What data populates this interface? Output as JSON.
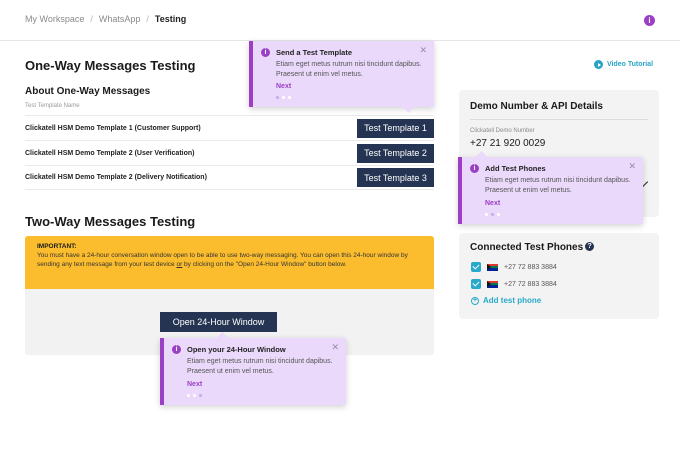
{
  "breadcrumb": {
    "items": [
      "My Workspace",
      "WhatsApp"
    ],
    "current": "Testing"
  },
  "one_way": {
    "title": "One-Way Messages Testing",
    "about": "About One-Way Messages",
    "column_label": "Test Template Name",
    "templates": [
      {
        "name": "Clickatell HSM Demo Template 1 (Customer Support)",
        "button": "Test Template 1"
      },
      {
        "name": "Clickatell HSM Demo Template 2 (User Verification)",
        "button": "Test Template 2"
      },
      {
        "name": "Clickatell HSM Demo Template 2 (Delivery Notification)",
        "button": "Test Template 3"
      }
    ]
  },
  "video_tutorial": "Video Tutorial",
  "demo_card": {
    "title": "Demo Number & API Details",
    "number_label": "Clickatell Demo Number",
    "number": "+27 21 920 0029"
  },
  "phones_card": {
    "title": "Connected Test Phones",
    "phones": [
      "+27 72 883 3884",
      "+27 72 883 3884"
    ],
    "add_label": "Add test phone"
  },
  "two_way": {
    "title": "Two-Way Messages Testing",
    "important_label": "IMPORTANT:",
    "important_text_1": "You must have a 24-hour conversation window open to be able to use two-way messaging. You can open this 24-hour window by sending any text message from your test device ",
    "important_or": "or",
    "important_text_2": " by clicking on the \"Open 24-Hour Window\" button below.",
    "open_button": "Open 24-Hour Window"
  },
  "tooltips": {
    "send": {
      "title": "Send a Test Template",
      "body": "Etiam eget metus rutrum nisi tincidunt dapibus. Praesent ut enim vel metus.",
      "next": "Next"
    },
    "phones": {
      "title": "Add Test Phones",
      "body": "Etiam eget metus rutrum nisi tincidunt dapibus. Praesent ut enim vel metus.",
      "next": "Next"
    },
    "window": {
      "title": "Open your 24-Hour Window",
      "body": "Etiam eget metus rutrum nisi tincidunt dapibus. Praesent ut enim vel metus.",
      "next": "Next"
    }
  },
  "colors": {
    "accent_purple": "#9b3fc4",
    "navy": "#253452",
    "cyan": "#29a9c9",
    "warning": "#fbbd2e"
  },
  "icons": {
    "info": "info-icon",
    "play": "play-icon",
    "help": "question-icon",
    "close": "close-icon",
    "check": "checkbox-icon",
    "flag": "south-africa-flag-icon"
  }
}
